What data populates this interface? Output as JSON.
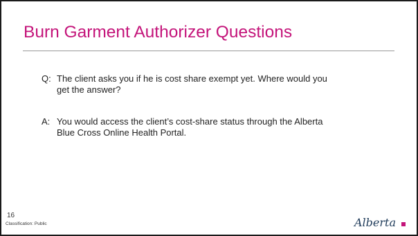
{
  "slide": {
    "title": "Burn Garment Authorizer Questions",
    "question": {
      "prefix": "Q:",
      "line1": "The client asks you if he is cost share exempt yet. Where would you",
      "line2": "get the answer?"
    },
    "answer": {
      "prefix": "A:",
      "line1": "You would access the client’s cost-share status through the Alberta",
      "line2": "Blue Cross Online Health Portal."
    },
    "slide_number": "16",
    "classification": "Classification: Public",
    "logo_text": "Alberta"
  },
  "colors": {
    "title": "#c4147a",
    "logo_text": "#1f3b5a",
    "logo_square": "#c4147a"
  }
}
